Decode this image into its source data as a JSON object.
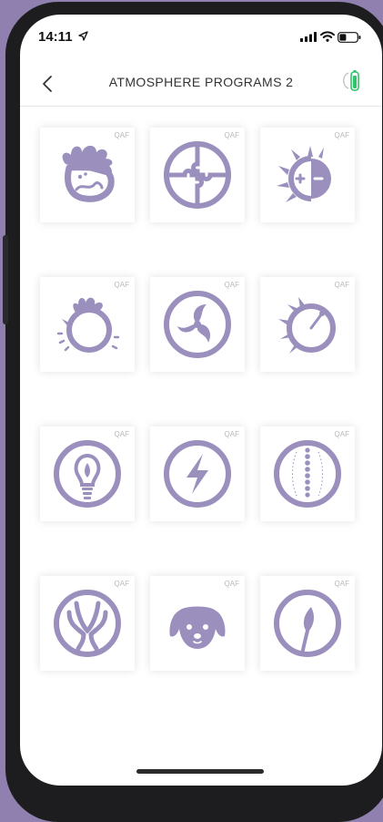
{
  "status_bar": {
    "time": "14:11"
  },
  "header": {
    "title": "ATMOSPHERE PROGRAMS 2"
  },
  "colors": {
    "accent": "#9a8fbd",
    "battery_green": "#2fc46b",
    "background": "#8f80b0"
  },
  "programs": [
    {
      "icon": "tousled-head-icon",
      "badge": "QAF"
    },
    {
      "icon": "puzzle-circle-icon",
      "badge": "QAF"
    },
    {
      "icon": "plus-minus-sun-icon",
      "badge": "QAF"
    },
    {
      "icon": "spiky-circle-icon",
      "badge": "QAF"
    },
    {
      "icon": "triskelion-icon",
      "badge": "QAF"
    },
    {
      "icon": "flame-gauge-icon",
      "badge": "QAF"
    },
    {
      "icon": "lightbulb-icon",
      "badge": "QAF"
    },
    {
      "icon": "lightning-icon",
      "badge": "QAF"
    },
    {
      "icon": "spine-icon",
      "badge": "QAF"
    },
    {
      "icon": "uterus-icon",
      "badge": "QAF"
    },
    {
      "icon": "dog-face-icon",
      "badge": "QAF"
    },
    {
      "icon": "leaf-circle-icon",
      "badge": "QAF"
    }
  ]
}
